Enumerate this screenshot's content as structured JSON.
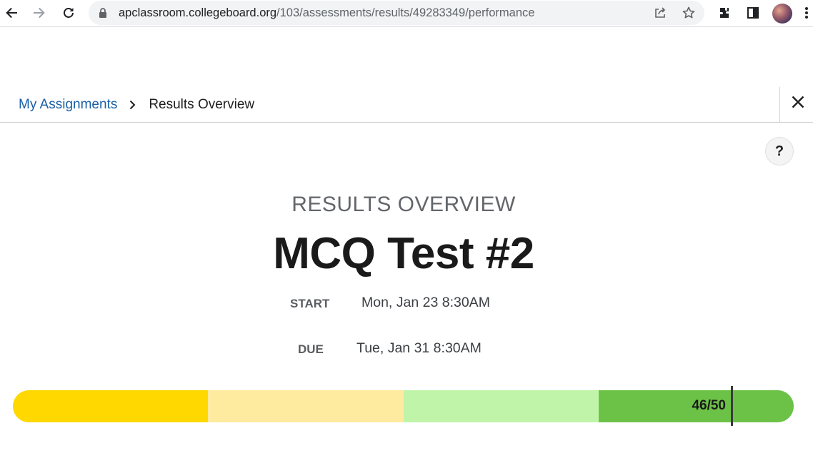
{
  "browser": {
    "url_host": "apclassroom.collegeboard.org",
    "url_path": "/103/assessments/results/49283349/performance",
    "icons": [
      "back-icon",
      "forward-icon",
      "reload-icon",
      "lock-icon",
      "share-icon",
      "star-icon",
      "extensions-icon",
      "side-panel-icon",
      "profile-avatar",
      "more-menu-icon"
    ]
  },
  "breadcrumb": {
    "link_label": "My Assignments",
    "current_label": "Results Overview"
  },
  "help": {
    "label": "?"
  },
  "main": {
    "eyebrow": "RESULTS OVERVIEW",
    "title": "MCQ Test #2",
    "start_label": "START",
    "start_value": "Mon, Jan 23 8:30AM",
    "due_label": "DUE",
    "due_value": "Tue, Jan 31 8:30AM"
  },
  "score": {
    "label": "46/50",
    "earned": 46,
    "total": 50,
    "segment_colors": [
      "#ffd800",
      "#ffeb9f",
      "#c0f4a9",
      "#6cc247"
    ]
  },
  "colors": {
    "link": "#1a5fa8",
    "title": "#1a1a1a",
    "muted": "#63666a"
  }
}
